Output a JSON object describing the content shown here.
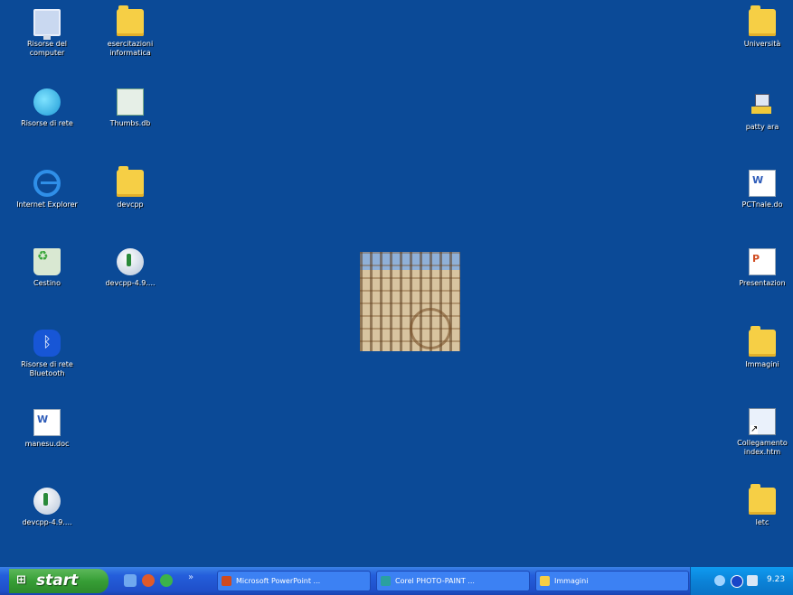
{
  "desktop": {
    "left_icons": [
      {
        "label": "Risorse del computer",
        "icon": "my-computer-icon"
      },
      {
        "label": "esercitazioni informatica",
        "icon": "folder-icon"
      },
      {
        "label": "Risorse di rete",
        "icon": "network-places-icon"
      },
      {
        "label": "Thumbs.db",
        "icon": "file-icon"
      },
      {
        "label": "Internet Explorer",
        "icon": "internet-explorer-icon"
      },
      {
        "label": "devcpp",
        "icon": "folder-icon"
      },
      {
        "label": "Cestino",
        "icon": "recycle-bin-icon"
      },
      {
        "label": "devcpp-4.9....",
        "icon": "setup-icon"
      },
      {
        "label": "Risorse di rete Bluetooth",
        "icon": "bluetooth-icon"
      },
      {
        "label": "manesu.doc",
        "icon": "word-document-icon"
      },
      {
        "label": "devcpp-4.9....",
        "icon": "setup-icon"
      }
    ],
    "right_icons": [
      {
        "label": "Università",
        "icon": "folder-icon"
      },
      {
        "label": "patty ara",
        "icon": "shared-drive-icon"
      },
      {
        "label": "PCTnale.do",
        "icon": "word-document-icon"
      },
      {
        "label": "Presentazion",
        "icon": "powerpoint-icon"
      },
      {
        "label": "Immagini",
        "icon": "folder-icon"
      },
      {
        "label": "Collegamento index.htm",
        "icon": "shortcut-icon"
      },
      {
        "label": "letc",
        "icon": "folder-icon"
      }
    ]
  },
  "taskbar": {
    "start_label": "start",
    "quick_launch": [
      "show-desktop-icon",
      "media-player-icon",
      "messenger-icon"
    ],
    "buttons": [
      {
        "label": "Microsoft PowerPoint ...",
        "icon": "powerpoint-icon",
        "color": "#d04a1f"
      },
      {
        "label": "Corel PHOTO-PAINT ...",
        "icon": "photo-paint-icon",
        "color": "#2aa0a0"
      },
      {
        "label": "Immagini",
        "icon": "folder-icon",
        "color": "#f6cf45"
      }
    ],
    "tray": {
      "icons": [
        "network-icon",
        "bluetooth-icon",
        "speaker-icon"
      ],
      "clock": "9.23"
    }
  },
  "colors": {
    "desktop_background": "#0b4a97",
    "taskbar": "#245edb",
    "start_button": "#379e36",
    "tray": "#0b83d8"
  }
}
